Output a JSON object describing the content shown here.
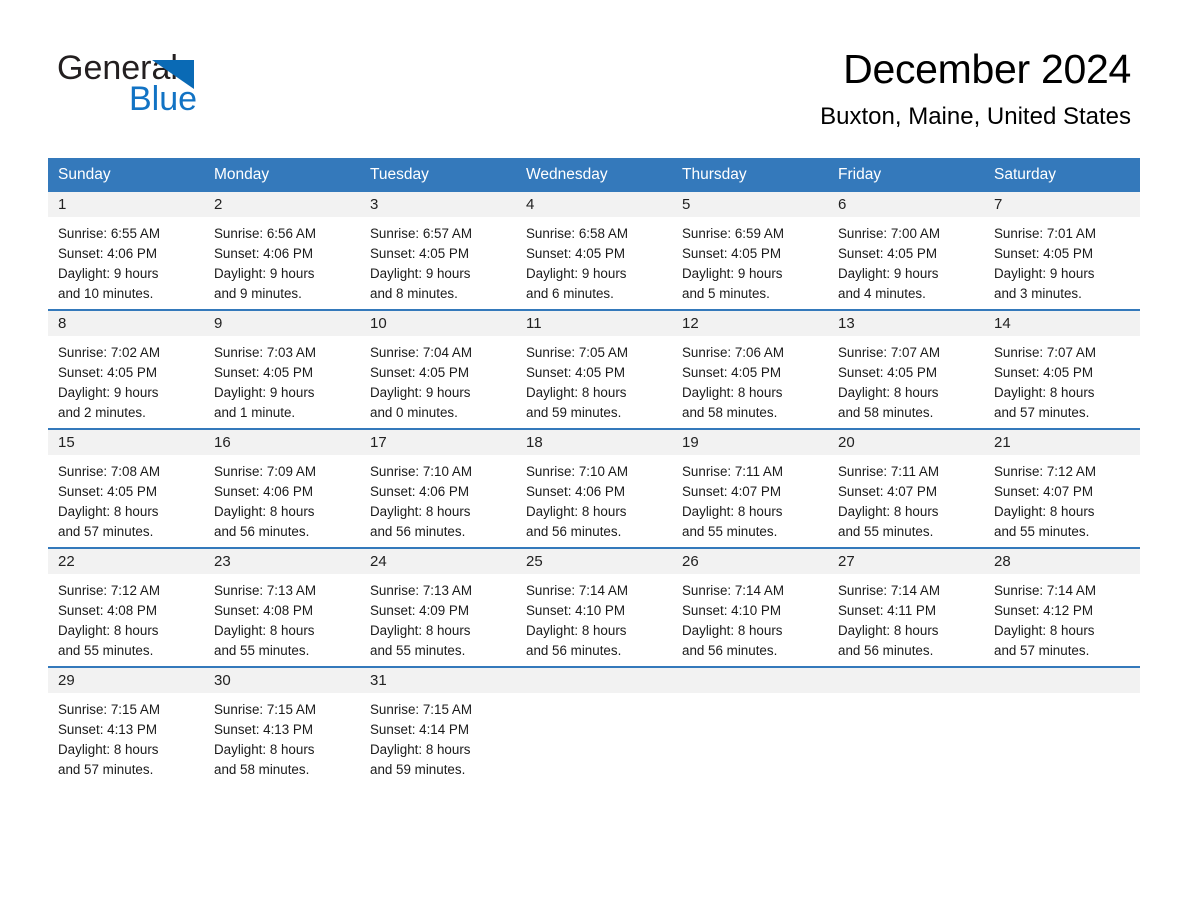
{
  "brand": {
    "name_part1": "General",
    "name_part2": "Blue",
    "logo_icon": "triangle-flag-icon",
    "accent_color": "#1273c4"
  },
  "header": {
    "title": "December 2024",
    "subtitle": "Buxton, Maine, United States"
  },
  "theme": {
    "header_row_bg": "#3479bb",
    "day_band_bg": "#f2f2f2",
    "row_divider": "#3479bb",
    "text": "#000000"
  },
  "weekdays": [
    "Sunday",
    "Monday",
    "Tuesday",
    "Wednesday",
    "Thursday",
    "Friday",
    "Saturday"
  ],
  "weeks": [
    [
      {
        "day": "1",
        "sunrise": "Sunrise: 6:55 AM",
        "sunset": "Sunset: 4:06 PM",
        "daylight1": "Daylight: 9 hours",
        "daylight2": "and 10 minutes."
      },
      {
        "day": "2",
        "sunrise": "Sunrise: 6:56 AM",
        "sunset": "Sunset: 4:06 PM",
        "daylight1": "Daylight: 9 hours",
        "daylight2": "and 9 minutes."
      },
      {
        "day": "3",
        "sunrise": "Sunrise: 6:57 AM",
        "sunset": "Sunset: 4:05 PM",
        "daylight1": "Daylight: 9 hours",
        "daylight2": "and 8 minutes."
      },
      {
        "day": "4",
        "sunrise": "Sunrise: 6:58 AM",
        "sunset": "Sunset: 4:05 PM",
        "daylight1": "Daylight: 9 hours",
        "daylight2": "and 6 minutes."
      },
      {
        "day": "5",
        "sunrise": "Sunrise: 6:59 AM",
        "sunset": "Sunset: 4:05 PM",
        "daylight1": "Daylight: 9 hours",
        "daylight2": "and 5 minutes."
      },
      {
        "day": "6",
        "sunrise": "Sunrise: 7:00 AM",
        "sunset": "Sunset: 4:05 PM",
        "daylight1": "Daylight: 9 hours",
        "daylight2": "and 4 minutes."
      },
      {
        "day": "7",
        "sunrise": "Sunrise: 7:01 AM",
        "sunset": "Sunset: 4:05 PM",
        "daylight1": "Daylight: 9 hours",
        "daylight2": "and 3 minutes."
      }
    ],
    [
      {
        "day": "8",
        "sunrise": "Sunrise: 7:02 AM",
        "sunset": "Sunset: 4:05 PM",
        "daylight1": "Daylight: 9 hours",
        "daylight2": "and 2 minutes."
      },
      {
        "day": "9",
        "sunrise": "Sunrise: 7:03 AM",
        "sunset": "Sunset: 4:05 PM",
        "daylight1": "Daylight: 9 hours",
        "daylight2": "and 1 minute."
      },
      {
        "day": "10",
        "sunrise": "Sunrise: 7:04 AM",
        "sunset": "Sunset: 4:05 PM",
        "daylight1": "Daylight: 9 hours",
        "daylight2": "and 0 minutes."
      },
      {
        "day": "11",
        "sunrise": "Sunrise: 7:05 AM",
        "sunset": "Sunset: 4:05 PM",
        "daylight1": "Daylight: 8 hours",
        "daylight2": "and 59 minutes."
      },
      {
        "day": "12",
        "sunrise": "Sunrise: 7:06 AM",
        "sunset": "Sunset: 4:05 PM",
        "daylight1": "Daylight: 8 hours",
        "daylight2": "and 58 minutes."
      },
      {
        "day": "13",
        "sunrise": "Sunrise: 7:07 AM",
        "sunset": "Sunset: 4:05 PM",
        "daylight1": "Daylight: 8 hours",
        "daylight2": "and 58 minutes."
      },
      {
        "day": "14",
        "sunrise": "Sunrise: 7:07 AM",
        "sunset": "Sunset: 4:05 PM",
        "daylight1": "Daylight: 8 hours",
        "daylight2": "and 57 minutes."
      }
    ],
    [
      {
        "day": "15",
        "sunrise": "Sunrise: 7:08 AM",
        "sunset": "Sunset: 4:05 PM",
        "daylight1": "Daylight: 8 hours",
        "daylight2": "and 57 minutes."
      },
      {
        "day": "16",
        "sunrise": "Sunrise: 7:09 AM",
        "sunset": "Sunset: 4:06 PM",
        "daylight1": "Daylight: 8 hours",
        "daylight2": "and 56 minutes."
      },
      {
        "day": "17",
        "sunrise": "Sunrise: 7:10 AM",
        "sunset": "Sunset: 4:06 PM",
        "daylight1": "Daylight: 8 hours",
        "daylight2": "and 56 minutes."
      },
      {
        "day": "18",
        "sunrise": "Sunrise: 7:10 AM",
        "sunset": "Sunset: 4:06 PM",
        "daylight1": "Daylight: 8 hours",
        "daylight2": "and 56 minutes."
      },
      {
        "day": "19",
        "sunrise": "Sunrise: 7:11 AM",
        "sunset": "Sunset: 4:07 PM",
        "daylight1": "Daylight: 8 hours",
        "daylight2": "and 55 minutes."
      },
      {
        "day": "20",
        "sunrise": "Sunrise: 7:11 AM",
        "sunset": "Sunset: 4:07 PM",
        "daylight1": "Daylight: 8 hours",
        "daylight2": "and 55 minutes."
      },
      {
        "day": "21",
        "sunrise": "Sunrise: 7:12 AM",
        "sunset": "Sunset: 4:07 PM",
        "daylight1": "Daylight: 8 hours",
        "daylight2": "and 55 minutes."
      }
    ],
    [
      {
        "day": "22",
        "sunrise": "Sunrise: 7:12 AM",
        "sunset": "Sunset: 4:08 PM",
        "daylight1": "Daylight: 8 hours",
        "daylight2": "and 55 minutes."
      },
      {
        "day": "23",
        "sunrise": "Sunrise: 7:13 AM",
        "sunset": "Sunset: 4:08 PM",
        "daylight1": "Daylight: 8 hours",
        "daylight2": "and 55 minutes."
      },
      {
        "day": "24",
        "sunrise": "Sunrise: 7:13 AM",
        "sunset": "Sunset: 4:09 PM",
        "daylight1": "Daylight: 8 hours",
        "daylight2": "and 55 minutes."
      },
      {
        "day": "25",
        "sunrise": "Sunrise: 7:14 AM",
        "sunset": "Sunset: 4:10 PM",
        "daylight1": "Daylight: 8 hours",
        "daylight2": "and 56 minutes."
      },
      {
        "day": "26",
        "sunrise": "Sunrise: 7:14 AM",
        "sunset": "Sunset: 4:10 PM",
        "daylight1": "Daylight: 8 hours",
        "daylight2": "and 56 minutes."
      },
      {
        "day": "27",
        "sunrise": "Sunrise: 7:14 AM",
        "sunset": "Sunset: 4:11 PM",
        "daylight1": "Daylight: 8 hours",
        "daylight2": "and 56 minutes."
      },
      {
        "day": "28",
        "sunrise": "Sunrise: 7:14 AM",
        "sunset": "Sunset: 4:12 PM",
        "daylight1": "Daylight: 8 hours",
        "daylight2": "and 57 minutes."
      }
    ],
    [
      {
        "day": "29",
        "sunrise": "Sunrise: 7:15 AM",
        "sunset": "Sunset: 4:13 PM",
        "daylight1": "Daylight: 8 hours",
        "daylight2": "and 57 minutes."
      },
      {
        "day": "30",
        "sunrise": "Sunrise: 7:15 AM",
        "sunset": "Sunset: 4:13 PM",
        "daylight1": "Daylight: 8 hours",
        "daylight2": "and 58 minutes."
      },
      {
        "day": "31",
        "sunrise": "Sunrise: 7:15 AM",
        "sunset": "Sunset: 4:14 PM",
        "daylight1": "Daylight: 8 hours",
        "daylight2": "and 59 minutes."
      },
      {
        "day": "",
        "sunrise": "",
        "sunset": "",
        "daylight1": "",
        "daylight2": ""
      },
      {
        "day": "",
        "sunrise": "",
        "sunset": "",
        "daylight1": "",
        "daylight2": ""
      },
      {
        "day": "",
        "sunrise": "",
        "sunset": "",
        "daylight1": "",
        "daylight2": ""
      },
      {
        "day": "",
        "sunrise": "",
        "sunset": "",
        "daylight1": "",
        "daylight2": ""
      }
    ]
  ]
}
